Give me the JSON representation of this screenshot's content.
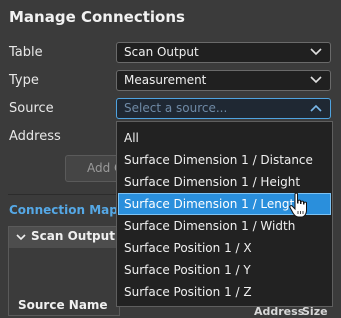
{
  "dialog": {
    "title": "Manage Connections"
  },
  "form": {
    "table_label": "Table",
    "table_value": "Scan Output",
    "type_label": "Type",
    "type_value": "Measurement",
    "source_label": "Source",
    "source_placeholder": "Select a source...",
    "address_label": "Address",
    "add_button_label": "Add C"
  },
  "connection_map": {
    "title": "Connection Map",
    "group_label": "Scan Output",
    "columns": {
      "source_name": "Source Name",
      "address": "Address",
      "size": "Size"
    }
  },
  "dropdown": {
    "items": [
      "All",
      "Surface Dimension 1 / Distance",
      "Surface Dimension 1 / Height",
      "Surface Dimension 1 / Length",
      "Surface Dimension 1 / Width",
      "Surface Position 1 / X",
      "Surface Position 1 / Y",
      "Surface Position 1 / Z"
    ],
    "highlighted_index": 3
  },
  "colors": {
    "background": "#3b3b3b",
    "field_bg": "#202020",
    "accent": "#2a8fdc",
    "section_title": "#55a8e6"
  }
}
